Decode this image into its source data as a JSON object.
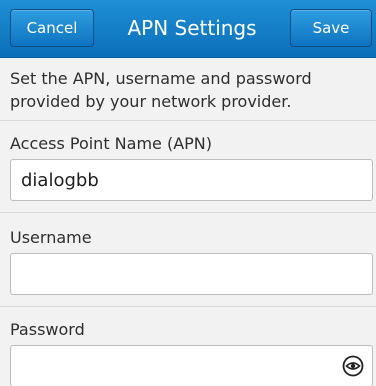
{
  "header": {
    "title": "APN Settings",
    "cancel_label": "Cancel",
    "save_label": "Save"
  },
  "intro": {
    "text": "Set the APN, username and password provided by your network provider."
  },
  "fields": {
    "apn": {
      "label": "Access Point Name (APN)",
      "value": "dialogbb"
    },
    "username": {
      "label": "Username",
      "value": ""
    },
    "password": {
      "label": "Password",
      "value": ""
    }
  },
  "icons": {
    "password_toggle": "eye-icon"
  },
  "colors": {
    "header_blue": "#0a6fb8",
    "background": "#f2f2f2"
  }
}
